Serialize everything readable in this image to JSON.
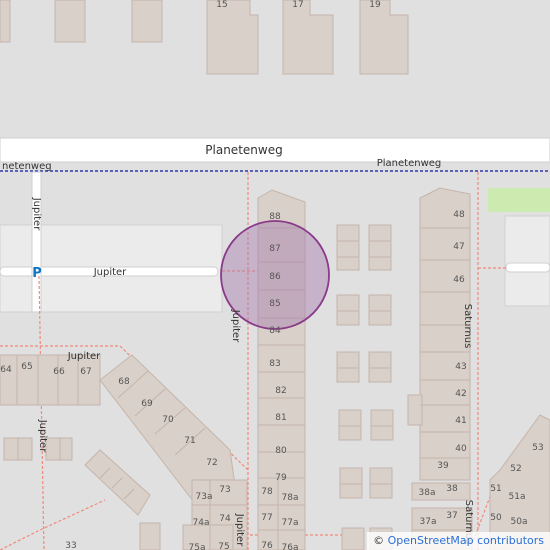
{
  "map": {
    "colors": {
      "background": "#e0e0e0",
      "road": "#ffffff",
      "road_casing": "#cfcfcf",
      "building": "#d9d0c9",
      "building_outline": "#c4b5ab",
      "footpath": "#f08a7a",
      "boundary": "#2d39a8",
      "grass": "#cdebb0",
      "marker_fill": "#a77db0",
      "marker_stroke": "#8a3a8a",
      "parking": "#0d75c7"
    },
    "streets": {
      "planetenweg_main": "Planetenweg",
      "planetenweg_secondary": "Planetenweg",
      "planetenweg_left": "netenweg",
      "jupiter_horizontal": "Jupiter",
      "jupiter_vertical_left": "Jupiter",
      "jupiter_vertical_mid": "Jupiter",
      "jupiter_lower": "Jupiter",
      "jupiter_bottom_left": "Jupiter",
      "jupiter_bottom_mid": "Jupiter",
      "saturnus_upper": "Saturnus",
      "saturnus_lower": "Saturnus"
    },
    "parking_symbol": "P",
    "house_numbers": {
      "top": [
        "15",
        "17",
        "19"
      ],
      "middle_column": [
        "88",
        "87",
        "86",
        "85",
        "84",
        "83",
        "82",
        "81",
        "80",
        "79",
        "78",
        "78a",
        "77",
        "77a",
        "76",
        "76a"
      ],
      "left_lower": [
        "64",
        "65",
        "66",
        "67",
        "68",
        "69",
        "70",
        "71",
        "72",
        "73",
        "73a",
        "74",
        "74a",
        "75",
        "75a",
        "33"
      ],
      "right_column": [
        "48",
        "47",
        "46",
        "43",
        "42",
        "41",
        "40",
        "39",
        "38",
        "38a",
        "37",
        "37a"
      ],
      "far_right": [
        "53",
        "52",
        "51",
        "51a",
        "50",
        "50a"
      ]
    }
  },
  "attribution": {
    "symbol": "©",
    "text": "OpenStreetMap contributors"
  }
}
